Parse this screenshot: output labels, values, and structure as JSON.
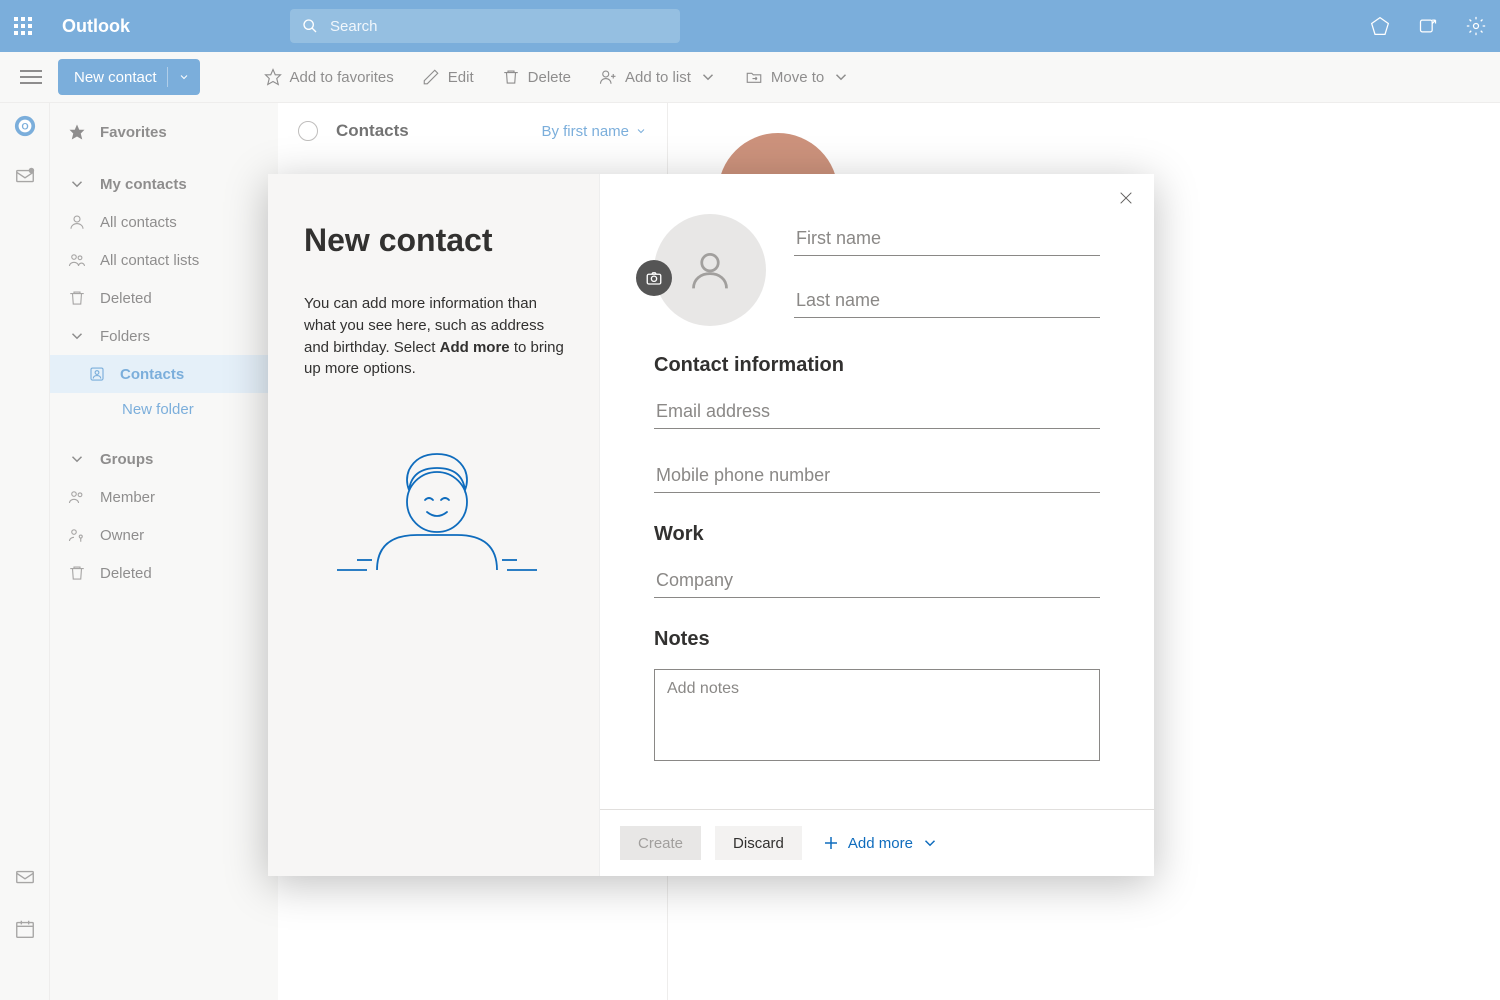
{
  "topbar": {
    "app_name": "Outlook",
    "search_placeholder": "Search"
  },
  "cmdbar": {
    "new_contact": "New contact",
    "favorites": "Add to favorites",
    "edit": "Edit",
    "delete": "Delete",
    "add_list": "Add to list",
    "move_to": "Move to"
  },
  "sidebar": {
    "favorites": "Favorites",
    "my_contacts": "My contacts",
    "all_contacts": "All contacts",
    "all_contact_lists": "All contact lists",
    "deleted": "Deleted",
    "folders": "Folders",
    "contacts": "Contacts",
    "new_folder": "New folder",
    "groups": "Groups",
    "member": "Member",
    "owner": "Owner",
    "deleted2": "Deleted"
  },
  "list": {
    "title": "Contacts",
    "sort": "By first name"
  },
  "modal": {
    "title": "New contact",
    "help_pre": "You can add more information than what you see here, such as address and birthday. Select ",
    "help_bold": "Add more",
    "help_post": " to bring up more options.",
    "first_name_ph": "First name",
    "last_name_ph": "Last name",
    "section_contact": "Contact information",
    "email_ph": "Email address",
    "mobile_ph": "Mobile phone number",
    "section_work": "Work",
    "company_ph": "Company",
    "section_notes": "Notes",
    "notes_ph": "Add notes",
    "create": "Create",
    "discard": "Discard",
    "add_more": "Add more"
  }
}
